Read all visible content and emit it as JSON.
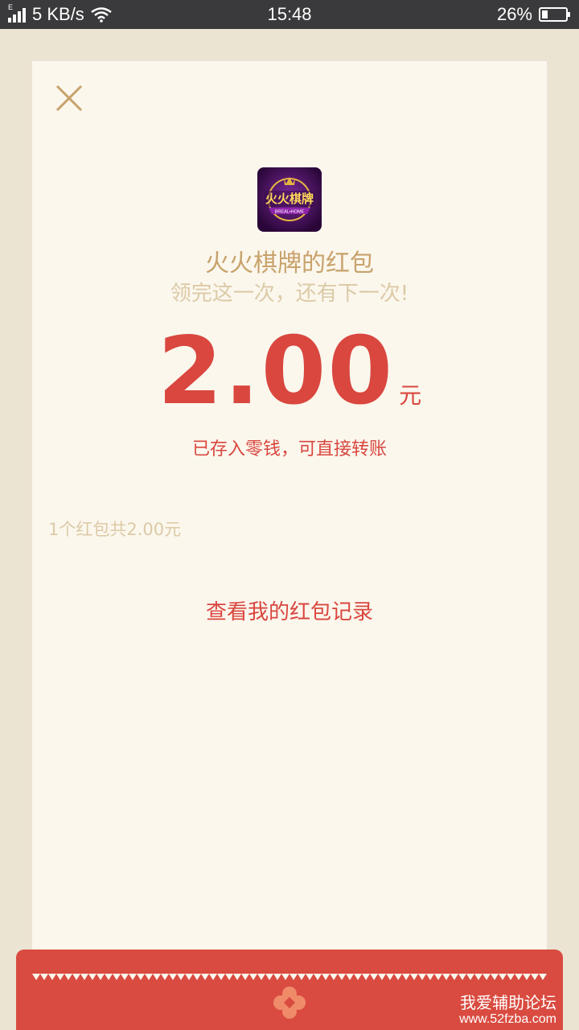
{
  "status_bar": {
    "network_type": "E",
    "speed": "5 KB/s",
    "time": "15:48",
    "battery_text": "26%",
    "battery_level": 0.26
  },
  "packet": {
    "sender_title": "火火棋牌的红包",
    "greeting": "领完这一次，还有下一次!",
    "amount": "2.00",
    "unit": "元",
    "stored_note": "已存入零钱，可直接转账",
    "summary": "1个红包共2.00元",
    "records_link": "查看我的红包记录"
  },
  "logo": {
    "main_text": "火火棋牌",
    "sub_text": "BREAL•HOME",
    "colors": {
      "bg": "#3a0c4e",
      "ring": "#e5b640",
      "ribbon": "#8e24aa"
    }
  },
  "watermark": {
    "line1": "我爱辅助论坛",
    "line2": "www.52fzba.com"
  },
  "colors": {
    "accent_red": "#d9473f",
    "gold_text": "#c8a26b",
    "muted_text": "#dccaa6",
    "card_bg": "#fbf7ed",
    "page_bg": "#ece4d3"
  },
  "icons": [
    "signal-icon",
    "wifi-icon",
    "battery-icon",
    "close-icon",
    "app-logo-icon",
    "flower-icon"
  ]
}
